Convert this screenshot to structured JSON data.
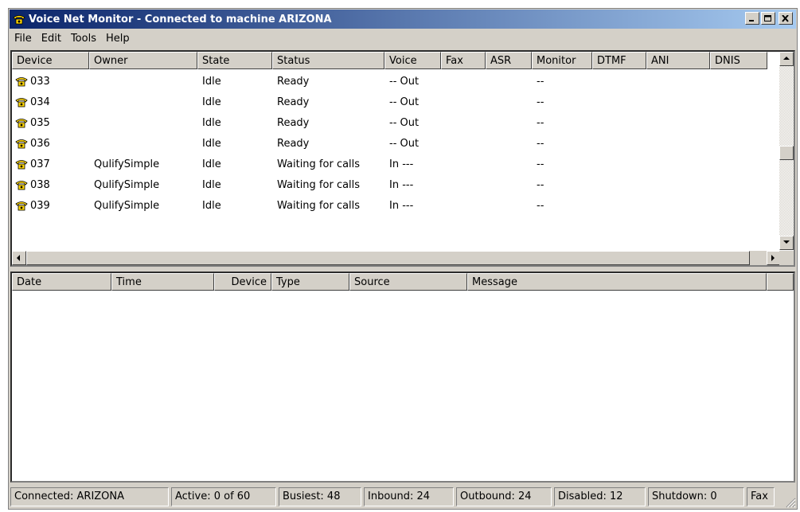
{
  "window": {
    "title": "Voice Net Monitor - Connected to machine ARIZONA"
  },
  "menu": [
    "File",
    "Edit",
    "Tools",
    "Help"
  ],
  "devices_table": {
    "columns": [
      "Device",
      "Owner",
      "State",
      "Status",
      "Voice",
      "Fax",
      "ASR",
      "Monitor",
      "DTMF",
      "ANI",
      "DNIS"
    ],
    "rows": [
      [
        "033",
        "",
        "Idle",
        "Ready",
        "-- Out",
        "",
        "",
        "--",
        "",
        "",
        ""
      ],
      [
        "034",
        "",
        "Idle",
        "Ready",
        "-- Out",
        "",
        "",
        "--",
        "",
        "",
        ""
      ],
      [
        "035",
        "",
        "Idle",
        "Ready",
        "-- Out",
        "",
        "",
        "--",
        "",
        "",
        ""
      ],
      [
        "036",
        "",
        "Idle",
        "Ready",
        "-- Out",
        "",
        "",
        "--",
        "",
        "",
        ""
      ],
      [
        "037",
        "QulifySimple",
        "Idle",
        "Waiting for calls",
        "In ---",
        "",
        "",
        "--",
        "",
        "",
        ""
      ],
      [
        "038",
        "QulifySimple",
        "Idle",
        "Waiting for calls",
        "In ---",
        "",
        "",
        "--",
        "",
        "",
        ""
      ],
      [
        "039",
        "QulifySimple",
        "Idle",
        "Waiting for calls",
        "In ---",
        "",
        "",
        "--",
        "",
        "",
        ""
      ]
    ]
  },
  "log_table": {
    "columns": [
      "Date",
      "Time",
      "Device",
      "Type",
      "Source",
      "Message"
    ],
    "rows": []
  },
  "statusbar": [
    "Connected: ARIZONA",
    "Active: 0 of 60",
    "Busiest: 48",
    "Inbound: 24",
    "Outbound: 24",
    "Disabled: 12",
    "Shutdown: 0",
    "Fax"
  ],
  "icons": {
    "app": "phone-icon",
    "device": "phone-icon"
  },
  "colors": {
    "title_start": "#0a246a",
    "title_end": "#a6caf0",
    "phone_icon": "#ffd700",
    "face": "#d4d0c8"
  }
}
